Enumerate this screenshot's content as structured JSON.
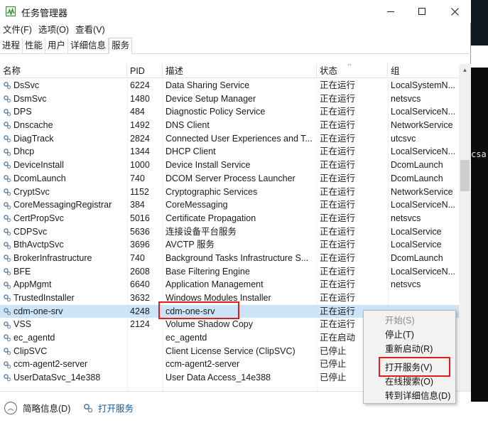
{
  "window": {
    "title": "任务管理器",
    "menu": [
      "文件(F)",
      "选项(O)",
      "查看(V)"
    ],
    "tabs": [
      "进程",
      "性能",
      "用户",
      "详细信息",
      "服务"
    ],
    "active_tab": "服务"
  },
  "table": {
    "columns": {
      "name": "名称",
      "pid": "PID",
      "desc": "描述",
      "status": "状态",
      "group": "组"
    },
    "rows": [
      {
        "name": "DsSvc",
        "pid": "6224",
        "desc": "Data Sharing Service",
        "status": "正在运行",
        "group": "LocalSystemN..."
      },
      {
        "name": "DsmSvc",
        "pid": "1480",
        "desc": "Device Setup Manager",
        "status": "正在运行",
        "group": "netsvcs"
      },
      {
        "name": "DPS",
        "pid": "484",
        "desc": "Diagnostic Policy Service",
        "status": "正在运行",
        "group": "LocalServiceN..."
      },
      {
        "name": "Dnscache",
        "pid": "1492",
        "desc": "DNS Client",
        "status": "正在运行",
        "group": "NetworkService"
      },
      {
        "name": "DiagTrack",
        "pid": "2824",
        "desc": "Connected User Experiences and T...",
        "status": "正在运行",
        "group": "utcsvc"
      },
      {
        "name": "Dhcp",
        "pid": "1344",
        "desc": "DHCP Client",
        "status": "正在运行",
        "group": "LocalServiceN..."
      },
      {
        "name": "DeviceInstall",
        "pid": "1000",
        "desc": "Device Install Service",
        "status": "正在运行",
        "group": "DcomLaunch"
      },
      {
        "name": "DcomLaunch",
        "pid": "740",
        "desc": "DCOM Server Process Launcher",
        "status": "正在运行",
        "group": "DcomLaunch"
      },
      {
        "name": "CryptSvc",
        "pid": "1152",
        "desc": "Cryptographic Services",
        "status": "正在运行",
        "group": "NetworkService"
      },
      {
        "name": "CoreMessagingRegistrar",
        "pid": "384",
        "desc": "CoreMessaging",
        "status": "正在运行",
        "group": "LocalServiceN..."
      },
      {
        "name": "CertPropSvc",
        "pid": "5016",
        "desc": "Certificate Propagation",
        "status": "正在运行",
        "group": "netsvcs"
      },
      {
        "name": "CDPSvc",
        "pid": "5636",
        "desc": "连接设备平台服务",
        "status": "正在运行",
        "group": "LocalService"
      },
      {
        "name": "BthAvctpSvc",
        "pid": "3696",
        "desc": "AVCTP 服务",
        "status": "正在运行",
        "group": "LocalService"
      },
      {
        "name": "BrokerInfrastructure",
        "pid": "740",
        "desc": "Background Tasks Infrastructure S...",
        "status": "正在运行",
        "group": "DcomLaunch"
      },
      {
        "name": "BFE",
        "pid": "2608",
        "desc": "Base Filtering Engine",
        "status": "正在运行",
        "group": "LocalServiceN..."
      },
      {
        "name": "AppMgmt",
        "pid": "6640",
        "desc": "Application Management",
        "status": "正在运行",
        "group": "netsvcs"
      },
      {
        "name": "TrustedInstaller",
        "pid": "3632",
        "desc": "Windows Modules Installer",
        "status": "正在运行",
        "group": ""
      },
      {
        "name": "cdm-one-srv",
        "pid": "4248",
        "desc": "cdm-one-srv",
        "status": "正在运行",
        "group": ""
      },
      {
        "name": "VSS",
        "pid": "2124",
        "desc": "Volume Shadow Copy",
        "status": "正在运行",
        "group": ""
      },
      {
        "name": "ec_agentd",
        "pid": "",
        "desc": "ec_agentd",
        "status": "正在启动",
        "group": ""
      },
      {
        "name": "ClipSVC",
        "pid": "",
        "desc": "Client License Service (ClipSVC)",
        "status": "已停止",
        "group": ""
      },
      {
        "name": "ccm-agent2-server",
        "pid": "",
        "desc": "ccm-agent2-server",
        "status": "已停止",
        "group": ""
      },
      {
        "name": "UserDataSvc_14e388",
        "pid": "",
        "desc": "User Data Access_14e388",
        "status": "已停止",
        "group": ""
      }
    ]
  },
  "context_menu": {
    "items": [
      "开始(S)",
      "停止(T)",
      "重新启动(R)",
      "打开服务(V)",
      "在线搜索(O)",
      "转到详细信息(D)"
    ]
  },
  "footer": {
    "brief": "简略信息(D)",
    "open_services": "打开服务"
  },
  "side_text": "csa"
}
